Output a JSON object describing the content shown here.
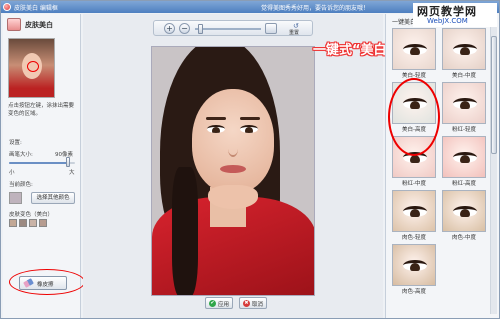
{
  "window": {
    "title": "皮肤美白 编辑框",
    "ad_text": "觉得美图秀秀好用，要告诉您的朋友哦！"
  },
  "watermark": {
    "title": "网页教学网",
    "url": "WebJX.COM"
  },
  "left_panel": {
    "tool_name": "皮肤美白",
    "hint": "点击按钮左键，涂抹出需要变色的区域。",
    "settings_label": "设置:",
    "brush_size_label": "画笔大小:",
    "brush_size_value": "90像素",
    "slider_min": "小",
    "slider_max": "大",
    "current_color_label": "当前颜色:",
    "choose_color_button": "选择其他颜色",
    "skin_color_label": "皮肤变色（美白）",
    "brush_size_fraction": 0.9,
    "swatches": [
      "#c2a896",
      "#9c8a82",
      "#c9b3a7",
      "#b69c90"
    ],
    "eraser_button": "橡皮擦"
  },
  "canvas": {
    "zoom_in": "+",
    "zoom_out": "−",
    "reset_label": "重置",
    "apply_button": "应用",
    "cancel_button": "取消"
  },
  "annotation": "一键式“美白”",
  "right_panel": {
    "header": "一键美白",
    "effects": [
      {
        "label": "美白-轻度",
        "tone": "#e8d6cd"
      },
      {
        "label": "美白-中度",
        "tone": "#e4d0c6"
      },
      {
        "label": "美白-高度",
        "tone": "#dfe3df"
      },
      {
        "label": "粉红-轻度",
        "tone": "#eccfc9"
      },
      {
        "label": "粉红-中度",
        "tone": "#f0c9c4"
      },
      {
        "label": "粉红-高度",
        "tone": "#f2c0bb"
      },
      {
        "label": "肉色-轻度",
        "tone": "#dcc2a8"
      },
      {
        "label": "肉色-中度",
        "tone": "#d8bfa3"
      },
      {
        "label": "肉色-高度",
        "tone": "#d6bba0"
      }
    ]
  },
  "colors": {
    "accent_red": "#e00000",
    "title_bar": "#4e7fc0"
  }
}
